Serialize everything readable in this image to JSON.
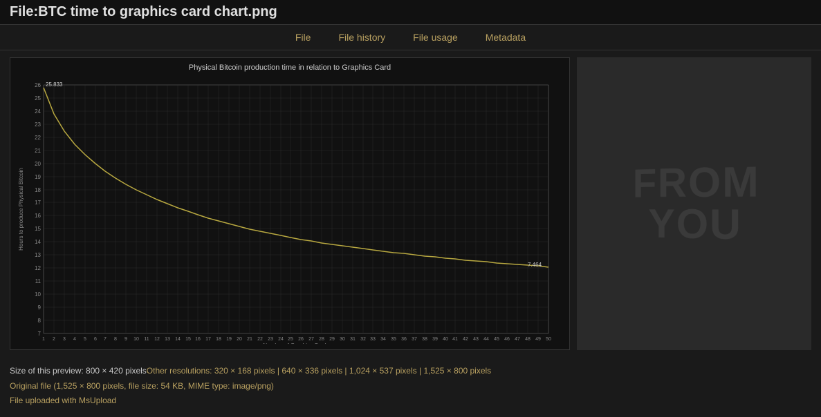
{
  "titleBar": {
    "title": "File:BTC time to graphics card chart.png"
  },
  "navTabs": {
    "items": [
      {
        "label": "File",
        "id": "file"
      },
      {
        "label": "File history",
        "id": "file-history"
      },
      {
        "label": "File usage",
        "id": "file-usage"
      },
      {
        "label": "Metadata",
        "id": "metadata"
      }
    ]
  },
  "chart": {
    "title": "Physical Bitcoin production time in relation to Graphics Card",
    "xLabel": "Number of Graphics Cards",
    "yLabel": "Hours to produce Physical Bitcoin",
    "maxY": 26,
    "minY": 7,
    "startValue": "25.833",
    "endValue": "7.464",
    "colors": {
      "background": "#111111",
      "grid": "#2a2a2a",
      "curve": "#b8a840",
      "axis": "#666666",
      "text": "#888888"
    }
  },
  "sidebar": {
    "text": "FROM\nYOU"
  },
  "fileInfo": {
    "previewLabel": "Size of this preview: ",
    "previewSize": "800 × 420 pixels",
    "otherResLabel": "Other resolutions: ",
    "resolutions": [
      {
        "label": "320 × 168 pixels",
        "link": "#"
      },
      {
        "label": "640 × 336 pixels",
        "link": "#"
      },
      {
        "label": "1,024 × 537 pixels",
        "link": "#"
      },
      {
        "label": "1,525 × 800 pixels",
        "link": "#"
      }
    ],
    "originalFile": "Original file",
    "originalDetails": "(1,525 × 800 pixels, file size: 54 KB, MIME type: image/png)",
    "uploadedWith": "File uploaded with MsUpload"
  }
}
